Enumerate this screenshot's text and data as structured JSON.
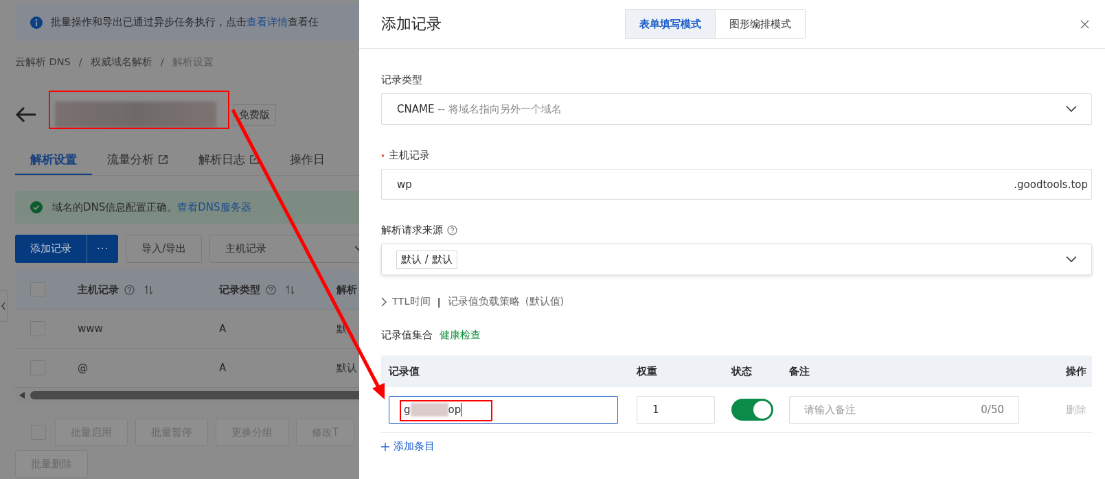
{
  "background_page": {
    "notice": {
      "text_before": "批量操作和导出已通过异步任务执行，点击",
      "link": "查看详情",
      "text_after": "查看任"
    },
    "breadcrumb": [
      {
        "label": "云解析 DNS",
        "current": false
      },
      {
        "label": "权威域名解析",
        "current": false
      },
      {
        "label": "解析设置",
        "current": true
      }
    ],
    "breadcrumb_separator": "/",
    "title": {
      "badge": "免费版"
    },
    "tabs": [
      {
        "label": "解析设置",
        "selected": true,
        "external": false
      },
      {
        "label": "流量分析",
        "selected": false,
        "external": true
      },
      {
        "label": "解析日志",
        "selected": false,
        "external": true
      },
      {
        "label": "操作日",
        "selected": false,
        "external": false
      }
    ],
    "dns_status": {
      "text": "域名的DNS信息配置正确。",
      "link": "查看DNS服务器"
    },
    "toolbar": {
      "primary": "添加记录",
      "more": "···",
      "import_export": "导入/导出",
      "filter": "主机记录"
    },
    "table": {
      "columns": [
        {
          "label": "主机记录",
          "help": true,
          "sortable": true
        },
        {
          "label": "记录类型",
          "help": true,
          "sortable": true
        },
        {
          "label": "解析"
        }
      ],
      "header_checked": false,
      "rows": [
        {
          "checked": false,
          "cells": [
            "www",
            "A",
            "默"
          ]
        },
        {
          "checked": false,
          "cells": [
            "@",
            "A",
            "默认"
          ]
        }
      ]
    },
    "bulk_actions": [
      "批量启用",
      "批量暂停",
      "更换分组",
      "修改T",
      "批量删除"
    ],
    "bulk_checked": false
  },
  "drawer": {
    "title": "添加记录",
    "modes": [
      {
        "label": "表单填写模式",
        "selected": true
      },
      {
        "label": "图形编排模式",
        "selected": false
      }
    ],
    "record_type": {
      "label": "记录类型",
      "value": "CNAME",
      "description": "-- 将域名指向另外一个域名"
    },
    "host_record": {
      "label": "主机记录",
      "required": true,
      "value": "wp",
      "suffix": ".goodtools.top"
    },
    "source": {
      "label": "解析请求来源",
      "help": true,
      "tags": [
        "默认 / 默认"
      ]
    },
    "ttl": {
      "expanded": false,
      "label": "TTL时间",
      "separator": "|",
      "strategy": "记录值负载策略",
      "strategy_value": "(默认值)"
    },
    "record_set": {
      "label": "记录值集合",
      "health_check": "健康检查"
    },
    "table": {
      "columns": [
        "记录值",
        "权重",
        "状态",
        "备注",
        "操作"
      ],
      "rows": [
        {
          "value_start": "g",
          "value_end": "op",
          "focused": true,
          "weight": "1",
          "enabled": true,
          "note_placeholder": "请输入备注",
          "note_count": "0/50",
          "action": "删除",
          "action_disabled": true
        }
      ]
    },
    "add_item": "添加条目"
  },
  "annotations": {
    "title_box": true,
    "value_box": true,
    "arrow": true
  }
}
